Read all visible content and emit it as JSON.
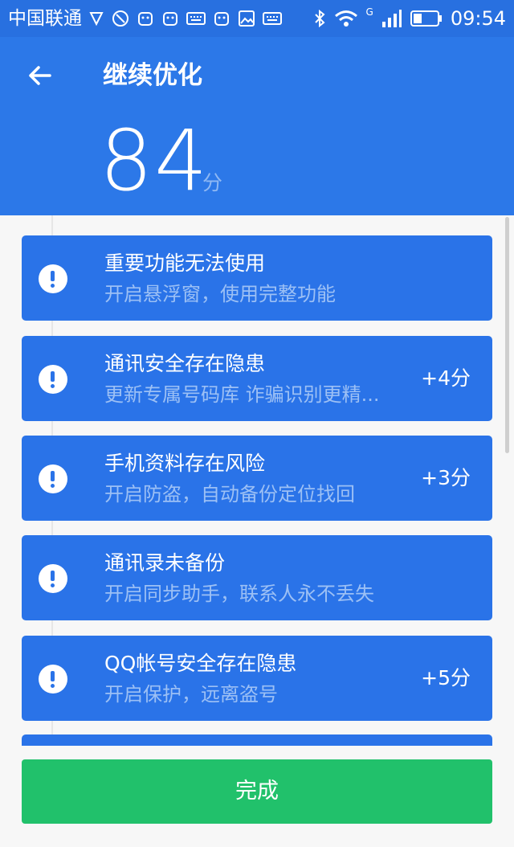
{
  "status_bar": {
    "carrier": "中国联通",
    "network": "G",
    "time": "09:54",
    "icons": [
      "vpn-icon",
      "app-notification-icon",
      "android-icon",
      "android-icon",
      "keyboard-icon",
      "android-icon",
      "image-icon",
      "keyboard-icon",
      "bluetooth-icon",
      "wifi-icon",
      "signal-icon",
      "battery-icon"
    ]
  },
  "header": {
    "title": "继续优化",
    "score": "84",
    "score_unit": "分",
    "background_color": "#2c78e8"
  },
  "items": [
    {
      "title": "重要功能无法使用",
      "subtitle": "开启悬浮窗，使用完整功能",
      "score": ""
    },
    {
      "title": "通讯安全存在隐患",
      "subtitle": "更新专属号码库 诈骗识别更精...",
      "score": "+4分"
    },
    {
      "title": "手机资料存在风险",
      "subtitle": "开启防盗，自动备份定位找回",
      "score": "+3分"
    },
    {
      "title": "通讯录未备份",
      "subtitle": "开启同步助手，联系人永不丢失",
      "score": ""
    },
    {
      "title": "QQ帐号安全存在隐患",
      "subtitle": "开启保护，远离盗号",
      "score": "+5分"
    }
  ],
  "footer": {
    "done_label": "完成",
    "done_color": "#21c16b"
  }
}
